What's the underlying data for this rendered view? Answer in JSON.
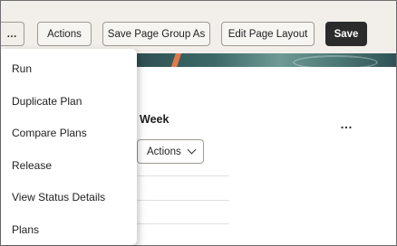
{
  "toolbar": {
    "overflow_label": "…",
    "actions_label": "Actions",
    "save_group_label": "Save Page Group As",
    "edit_layout_label": "Edit Page Layout",
    "save_label": "Save"
  },
  "content": {
    "section_title": "Week",
    "more_label": "…",
    "actions_dropdown_label": "Actions"
  },
  "menu": {
    "items": [
      {
        "label": "Run"
      },
      {
        "label": "Duplicate Plan"
      },
      {
        "label": "Compare Plans"
      },
      {
        "label": "Release"
      },
      {
        "label": "View Status Details"
      },
      {
        "label": "Plans"
      }
    ]
  },
  "colors": {
    "save_button_bg": "#2b2b2b",
    "toolbar_bg": "#f2efea",
    "banner_teal": "#3c6a69"
  },
  "icons": {
    "overflow": "more-horizontal-icon",
    "dropdown": "chevron-down-icon",
    "kebab": "more-horizontal-icon"
  }
}
